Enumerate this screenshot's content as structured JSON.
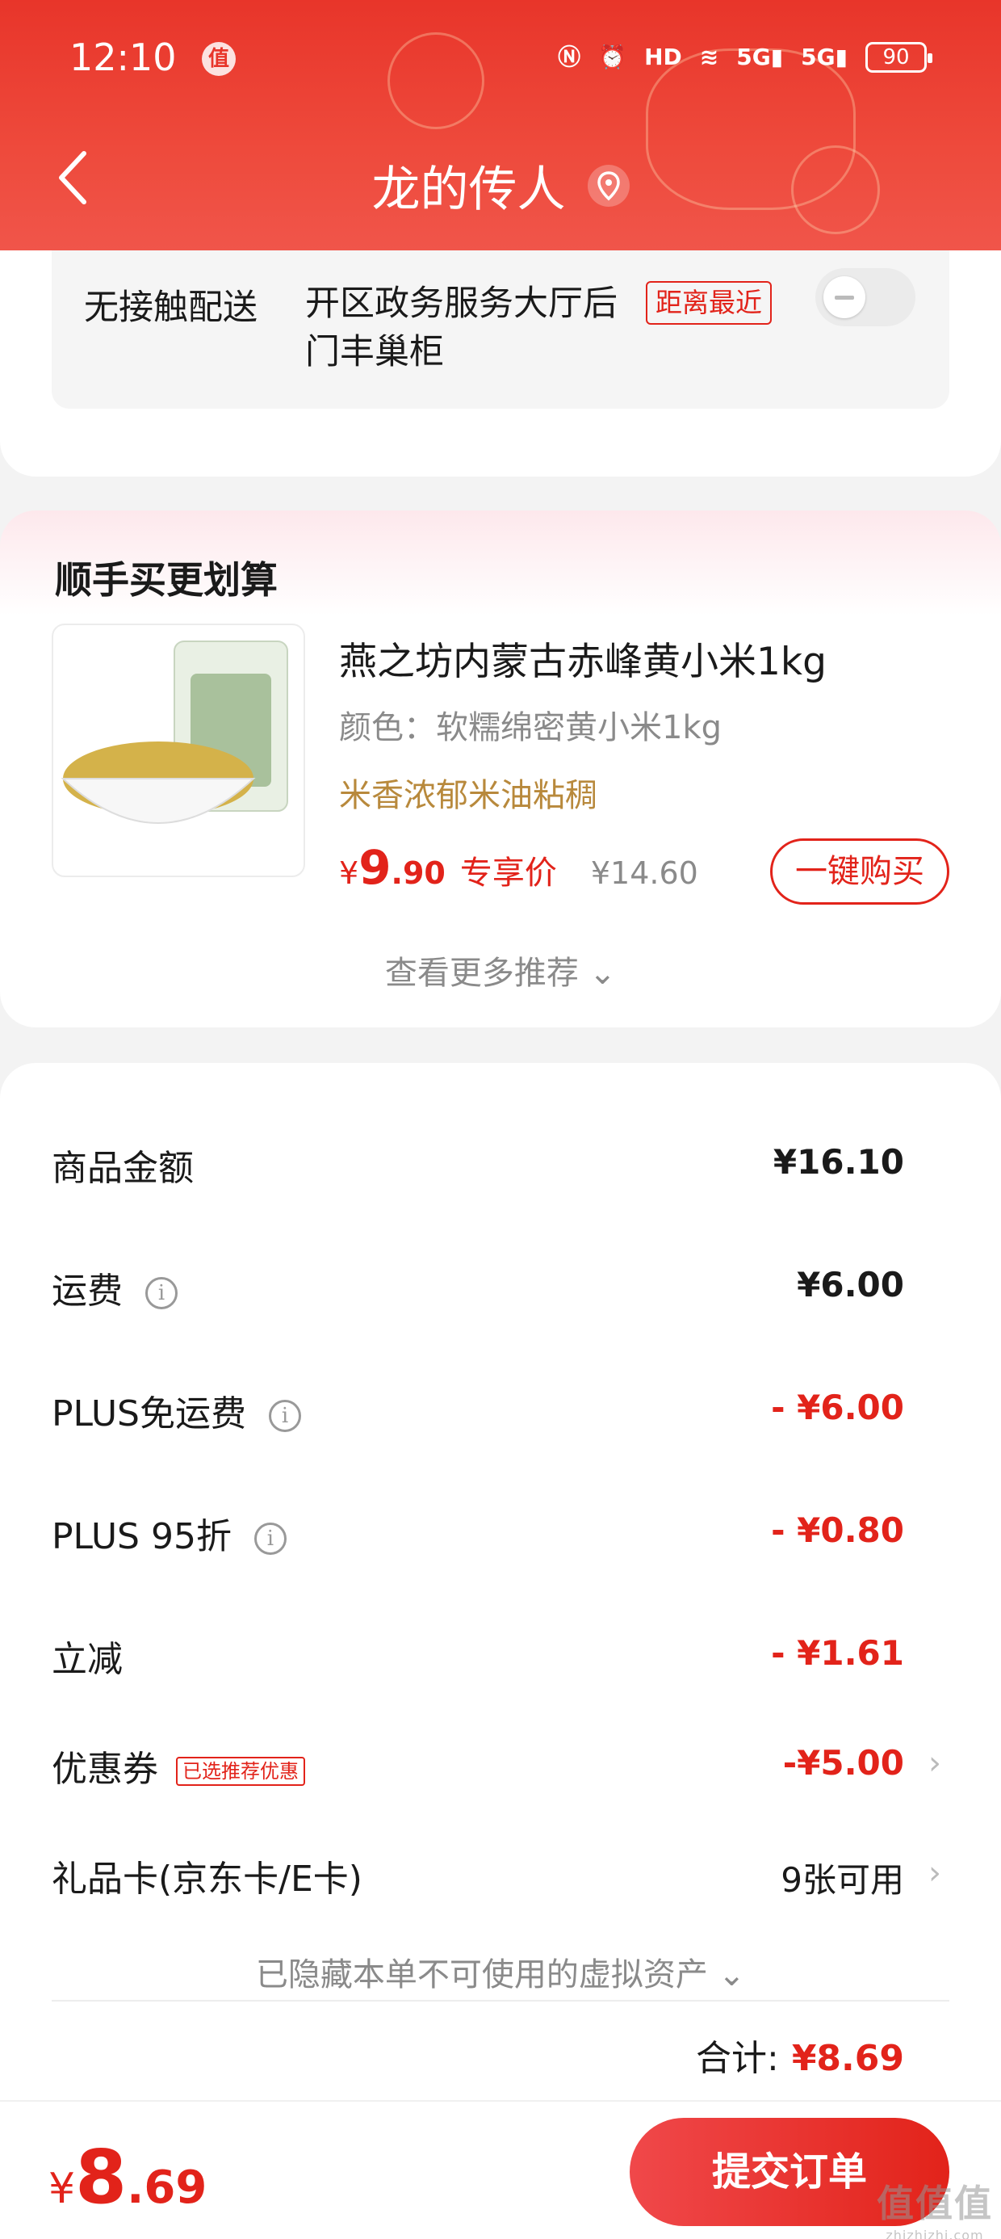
{
  "status_bar": {
    "time": "12:10",
    "app_badge": "值",
    "network_1": "5G",
    "network_2": "5G",
    "battery": "90"
  },
  "header": {
    "title": "龙的传人"
  },
  "delivery": {
    "type": "无接触配送",
    "address": "开区政务服务大厅后门丰巢柜",
    "badge": "距离最近"
  },
  "recommend": {
    "section_title": "顺手买更划算",
    "product": {
      "name": "燕之坊内蒙古赤峰黄小米1kg",
      "color": "颜色：软糯绵密黄小米1kg",
      "tagline": "米香浓郁米油粘稠",
      "price_symbol": "¥",
      "price_int": "9",
      "price_dec": ".90",
      "price_label": "专享价",
      "original_price": "¥14.60",
      "buy_label": "一键购买"
    },
    "more_label": "查看更多推荐"
  },
  "summary": {
    "rows": [
      {
        "label": "商品金额",
        "value": "¥16.10"
      },
      {
        "label": "运费",
        "value": "¥6.00"
      },
      {
        "label": "PLUS免运费",
        "value": "- ¥6.00"
      },
      {
        "label": "PLUS 95折",
        "value": "- ¥0.80"
      },
      {
        "label": "立减",
        "value": "- ¥1.61"
      },
      {
        "label": "优惠券",
        "tag": "已选推荐优惠",
        "value": "-¥5.00"
      },
      {
        "label": "礼品卡(京东卡/E卡)",
        "value": "9张可用"
      }
    ],
    "hidden_assets": "已隐藏本单不可使用的虚拟资产",
    "total_label": "合计:",
    "total_value": "¥8.69"
  },
  "bottom_bar": {
    "price_symbol": "¥",
    "price_int": "8",
    "price_dec": ".69",
    "submit_label": "提交订单"
  },
  "watermark": {
    "text": "值值值",
    "sub": "zhizhizhi.com"
  },
  "colors": {
    "brand_red": "#e2231a",
    "header_red": "#e8352a",
    "gold": "#b8893c"
  }
}
